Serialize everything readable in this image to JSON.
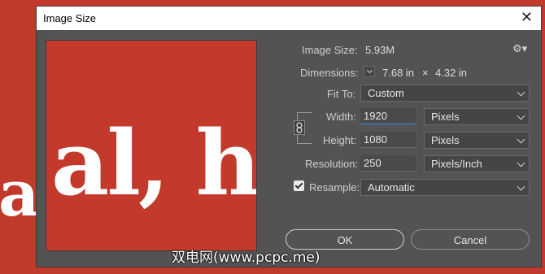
{
  "background": {
    "text": "al"
  },
  "dialog": {
    "title": "Image Size",
    "preview_text": "al, ho",
    "image_size": {
      "label": "Image Size:",
      "value": "5.93M"
    },
    "dimensions": {
      "label": "Dimensions:",
      "width": "7.68 in",
      "times": "×",
      "height": "4.32 in"
    },
    "fit_to": {
      "label": "Fit To:",
      "value": "Custom"
    },
    "width": {
      "label": "Width:",
      "value": "1920",
      "unit": "Pixels"
    },
    "height": {
      "label": "Height:",
      "value": "1080",
      "unit": "Pixels"
    },
    "resolution": {
      "label": "Resolution:",
      "value": "250",
      "unit": "Pixels/Inch"
    },
    "resample": {
      "label": "Resample:",
      "value": "Automatic",
      "checked": true
    },
    "buttons": {
      "ok": "OK",
      "cancel": "Cancel"
    }
  },
  "watermark": "双电网(www.pcpc.me)",
  "colors": {
    "background": "#c0392b",
    "dialog": "#535353",
    "focus": "#3d8ee6"
  }
}
